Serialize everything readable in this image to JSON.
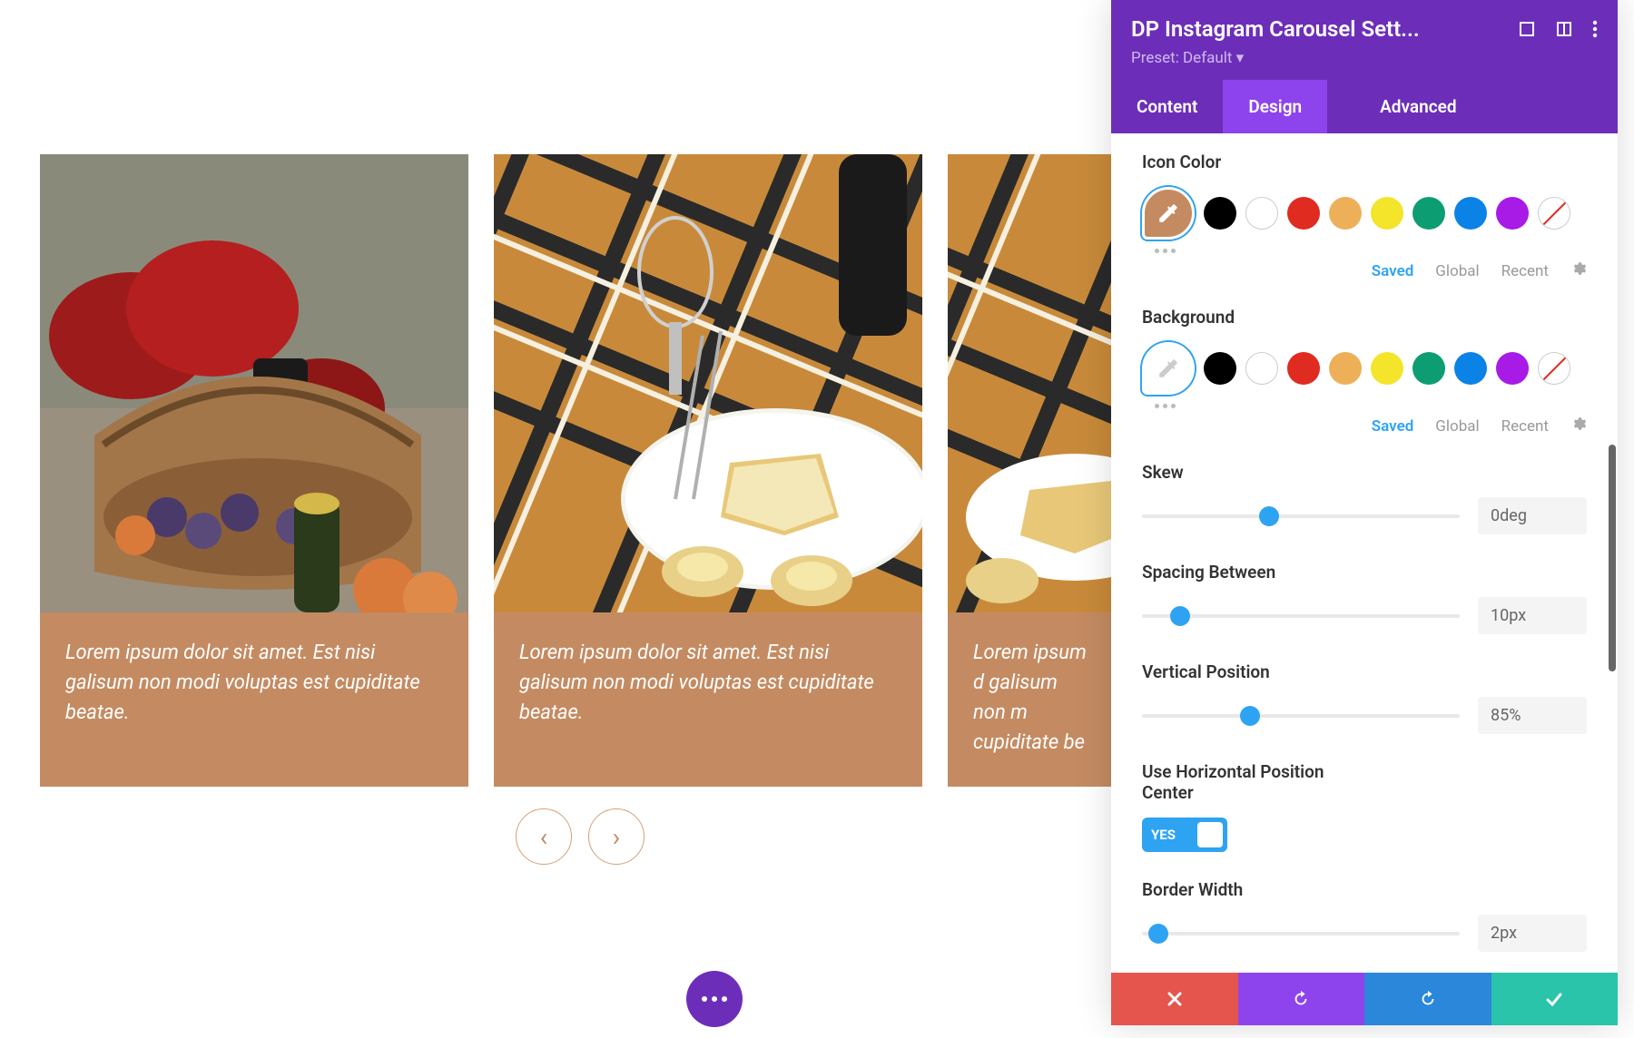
{
  "carousel": {
    "cards": [
      {
        "caption": "Lorem ipsum dolor sit amet. Est nisi galisum non modi voluptas est cupiditate beatae."
      },
      {
        "caption": "Lorem ipsum dolor sit amet. Est nisi galisum non modi voluptas est cupiditate beatae."
      },
      {
        "caption": "Lorem ipsum d galisum non m cupiditate be"
      }
    ]
  },
  "panel": {
    "title": "DP Instagram Carousel Sett...",
    "preset": "Preset: Default ▾",
    "tabs": {
      "content": "Content",
      "design": "Design",
      "advanced": "Advanced"
    },
    "icon_color": {
      "label": "Icon Color"
    },
    "background": {
      "label": "Background"
    },
    "swatch_tabs": {
      "saved": "Saved",
      "global": "Global",
      "recent": "Recent"
    },
    "skew": {
      "label": "Skew",
      "value": "0deg",
      "pos": 40
    },
    "spacing": {
      "label": "Spacing Between",
      "value": "10px",
      "pos": 12
    },
    "vpos": {
      "label": "Vertical Position",
      "value": "85%",
      "pos": 34
    },
    "hcenter": {
      "label": "Use Horizontal Position Center",
      "value": "YES"
    },
    "border": {
      "label": "Border Width",
      "value": "2px",
      "pos": 5
    }
  }
}
